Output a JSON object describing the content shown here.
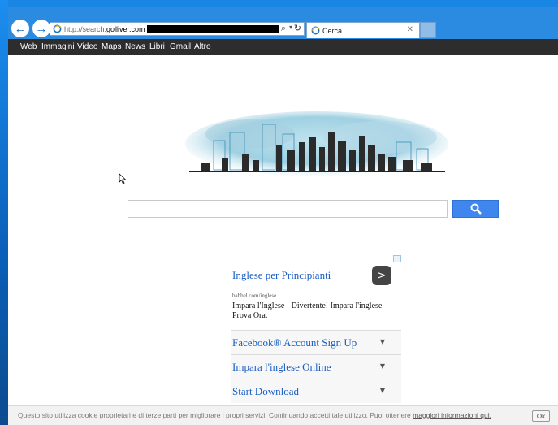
{
  "browser": {
    "address": {
      "url_prefix": "http://search.",
      "url_host": "golliver.com"
    },
    "tab": {
      "title": "Cerca"
    },
    "nav": {
      "back": "←",
      "forward": "→"
    }
  },
  "menu": {
    "items": [
      "Web",
      "Immagini",
      "Video",
      "Maps",
      "News",
      "Libri",
      "Gmail",
      "Altro"
    ]
  },
  "ad": {
    "title": "Inglese per Principianti",
    "url": "babbel.com/inglese",
    "description": "Impara l'Inglese - Divertente! Impara l'inglese - Prova Ora.",
    "rows": [
      "Facebook® Account Sign Up",
      "Impara l'inglese Online",
      "Start Download"
    ]
  },
  "cookie": {
    "text": "Questo sito utilizza cookie proprietari e di terze parti per migliorare i propri servizi. Continuando accetti tale utilizzo. Puoi ottenere ",
    "link": "maggiori informazioni qui.",
    "ok": "Ok"
  },
  "colors": {
    "accent": "#3f86ee",
    "menubar": "#2d2d2d",
    "link": "#1a5ec2"
  }
}
